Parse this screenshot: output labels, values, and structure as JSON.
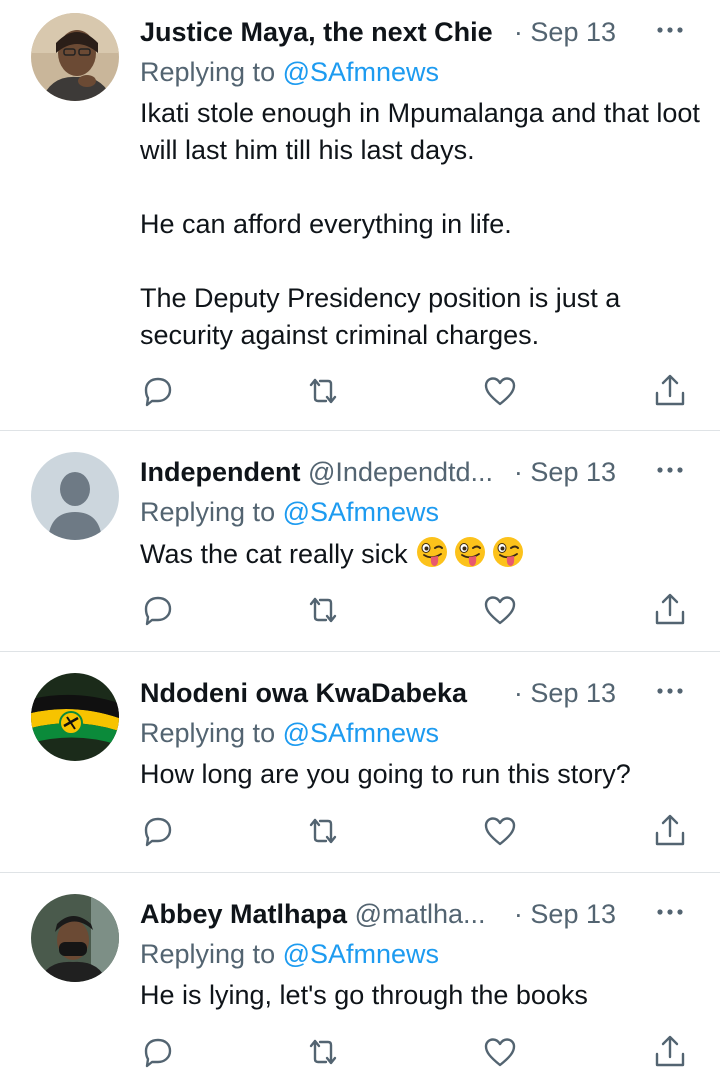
{
  "tweets": [
    {
      "name": "Justice Maya, the next Chie",
      "handle": "",
      "date": "Sep 13",
      "replying_label": "Replying to",
      "replying_to": "@SAfmnews",
      "paragraphs": [
        "Ikati stole enough in Mpumalanga and that loot will last him till his last days.",
        "He can afford everything in life.",
        "The Deputy Presidency position is just a security against criminal charges."
      ],
      "avatar": "woman-photo-avatar"
    },
    {
      "name": "Independent",
      "handle": "@Independtd...",
      "date": "Sep 13",
      "replying_label": "Replying to",
      "replying_to": "@SAfmnews",
      "paragraphs": [
        "Was the cat really sick"
      ],
      "emojis": [
        "winking-face-tongue-emoji",
        "winking-face-tongue-emoji",
        "winking-face-tongue-emoji"
      ],
      "avatar": "default-avatar"
    },
    {
      "name": "Ndodeni owa KwaDabeka",
      "handle": "",
      "date": "Sep 13",
      "replying_label": "Replying to",
      "replying_to": "@SAfmnews",
      "paragraphs": [
        "How long are you going to run this story?"
      ],
      "avatar": "anc-flag-avatar"
    },
    {
      "name": "Abbey Matlhapa",
      "handle": "@matlha...",
      "date": "Sep 13",
      "replying_label": "Replying to",
      "replying_to": "@SAfmnews",
      "paragraphs": [
        "He is lying, let's go through the books"
      ],
      "avatar": "man-photo-avatar"
    }
  ],
  "icons": {
    "reply": "reply-icon",
    "retweet": "retweet-icon",
    "like": "like-icon",
    "share": "share-icon",
    "more": "more-icon"
  },
  "colors": {
    "text": "#0f1419",
    "secondary": "#536471",
    "mention": "#1d9bf0",
    "divider": "#dfe3e6"
  }
}
